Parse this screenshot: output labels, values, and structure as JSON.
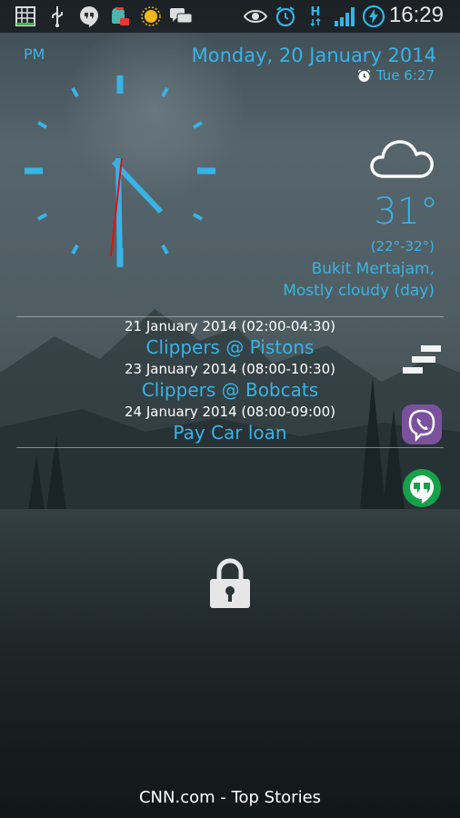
{
  "status_bar": {
    "time": "16:29",
    "network_label": "H",
    "icons": [
      "grid-icon",
      "usb-icon",
      "hangouts-icon",
      "android-debug-icon",
      "weather-sun-icon",
      "chat-icon",
      "eye-icon",
      "alarm-icon",
      "network-h-icon",
      "signal-icon",
      "battery-charging-icon"
    ]
  },
  "clock": {
    "period": "PM"
  },
  "date_widget": {
    "date": "Monday, 20 January 2014",
    "alarm": "Tue 6:27"
  },
  "weather": {
    "icon": "cloud-icon",
    "temperature": "31°",
    "range": "(22°-32°)",
    "location": "Bukit Mertajam,",
    "condition": "Mostly cloudy (day)"
  },
  "events": [
    {
      "date": "21 January 2014 (02:00-04:30)",
      "title": "Clippers @ Pistons"
    },
    {
      "date": "23 January 2014 (08:00-10:30)",
      "title": "Clippers @ Bobcats"
    },
    {
      "date": "24 January 2014 (08:00-09:00)",
      "title": "Pay Car loan"
    }
  ],
  "shortcuts": [
    "menu-icon",
    "viber-icon",
    "hangouts-icon"
  ],
  "lock": {
    "icon": "padlock-icon"
  },
  "footer": {
    "ticker": "CNN.com - Top Stories"
  },
  "colors": {
    "accent": "#38b3e6",
    "second_hand": "#e01010"
  }
}
